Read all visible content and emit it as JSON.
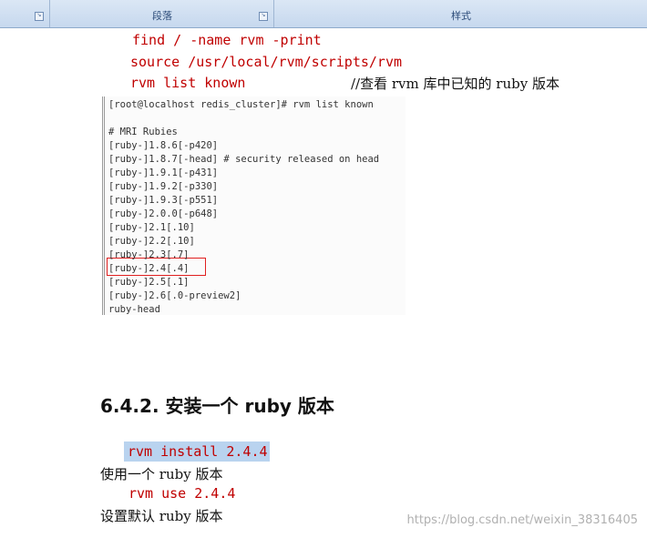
{
  "ribbon": {
    "group_2_caption": "段落",
    "group_3_caption": "样式"
  },
  "commands": {
    "find": "find / -name rvm -print",
    "source": "source /usr/local/rvm/scripts/rvm",
    "list_known": "rvm list known",
    "list_known_comment": "//查看 rvm 库中已知的 ruby 版本"
  },
  "terminal": {
    "lines": [
      "[root@localhost redis_cluster]# rvm list known",
      "",
      "# MRI Rubies",
      "[ruby-]1.8.6[-p420]",
      "[ruby-]1.8.7[-head] # security released on head",
      "[ruby-]1.9.1[-p431]",
      "[ruby-]1.9.2[-p330]",
      "[ruby-]1.9.3[-p551]",
      "[ruby-]2.0.0[-p648]",
      "[ruby-]2.1[.10]",
      "[ruby-]2.2[.10]",
      "[ruby-]2.3[.7]",
      "[ruby-]2.4[.4]",
      "[ruby-]2.5[.1]",
      "[ruby-]2.6[.0-preview2]",
      "ruby-head"
    ],
    "highlighted_line": "[ruby-]2.4[.4]"
  },
  "section": {
    "heading": "6.4.2. 安装一个 ruby 版本",
    "install_command": "rvm install 2.4.4",
    "use_text": "使用一个 ruby 版本",
    "use_command": "rvm use 2.4.4",
    "default_text": "设置默认 ruby 版本"
  },
  "watermark": "https://blog.csdn.net/weixin_38316405",
  "colors": {
    "code_red": "#c00000",
    "highlight_box": "#e02020",
    "selection_blue": "#b9d3ef"
  }
}
